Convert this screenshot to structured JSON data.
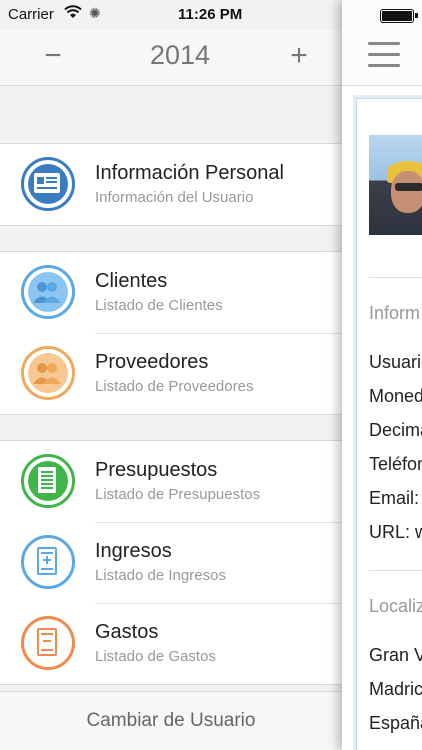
{
  "status_bar": {
    "carrier": "Carrier",
    "time": "11:26 PM"
  },
  "year_selector": {
    "decrement": "−",
    "year": "2014",
    "increment": "+"
  },
  "menu": [
    {
      "title": "Información Personal",
      "subtitle": "Información del Usuario",
      "icon": "id-card-icon",
      "color": "#3a7cc0"
    },
    {
      "title": "Clientes",
      "subtitle": "Listado de Clientes",
      "icon": "people-icon",
      "color": "#5aa9e6"
    },
    {
      "title": "Proveedores",
      "subtitle": "Listado de Proveedores",
      "icon": "people-icon",
      "color": "#f0a85a"
    },
    {
      "title": "Presupuestos",
      "subtitle": "Listado de Presupuestos",
      "icon": "document-lines-icon",
      "color": "#3fb54a"
    },
    {
      "title": "Ingresos",
      "subtitle": "Listado de Ingresos",
      "icon": "document-plus-icon",
      "color": "#5aa9e6"
    },
    {
      "title": "Gastos",
      "subtitle": "Listado de Gastos",
      "icon": "document-minus-icon",
      "color": "#ee8a4e"
    }
  ],
  "footer": {
    "switch_user": "Cambiar de Usuario"
  },
  "detail_panel": {
    "section_info": "Inform",
    "fields": [
      "Usuario",
      "Moned",
      "Decima",
      "Teléfon",
      "Email:",
      "URL: w"
    ],
    "section_location": "Localiz",
    "location_lines": [
      "Gran V",
      "Madric",
      "España"
    ]
  }
}
